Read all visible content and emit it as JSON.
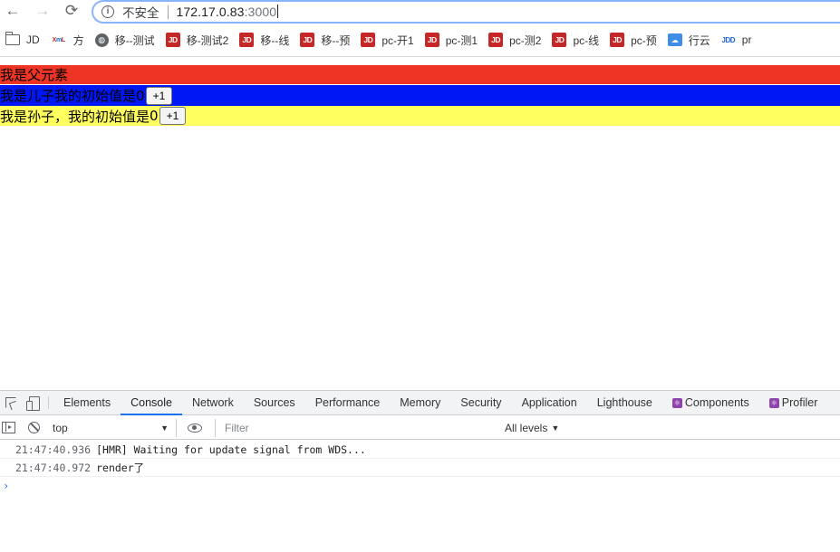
{
  "browser": {
    "back_icon": "←",
    "forward_icon": "→",
    "reload_icon": "⟳",
    "security_label": "不安全",
    "url_host": "172.17.0.83",
    "url_port": ":3000"
  },
  "bookmarks": [
    {
      "icon": "folder-icon",
      "label": "JD"
    },
    {
      "icon": "xl-icon",
      "label": "方"
    },
    {
      "icon": "globe-icon",
      "label": "移--测试"
    },
    {
      "icon": "jd-icon",
      "label": "移-测试2"
    },
    {
      "icon": "jd-icon",
      "label": "移--线"
    },
    {
      "icon": "jd-icon",
      "label": "移--预"
    },
    {
      "icon": "jd-icon",
      "label": "pc-开1"
    },
    {
      "icon": "jd-icon",
      "label": "pc-测1"
    },
    {
      "icon": "jd-icon",
      "label": "pc-测2"
    },
    {
      "icon": "jd-icon",
      "label": "pc-线"
    },
    {
      "icon": "jd-icon",
      "label": "pc-预"
    },
    {
      "icon": "cloud-icon",
      "label": "行云"
    },
    {
      "icon": "jdd-icon",
      "label": "pr"
    }
  ],
  "page": {
    "parent_text": "我是父元素",
    "child_text": "我是儿子我的初始值是",
    "child_value": "0",
    "grandchild_text": "我是孙子，我的初始值是",
    "grandchild_value": "0",
    "increment_label": "+1"
  },
  "devtools": {
    "tabs": [
      {
        "label": "Elements",
        "active": false
      },
      {
        "label": "Console",
        "active": true
      },
      {
        "label": "Network",
        "active": false
      },
      {
        "label": "Sources",
        "active": false
      },
      {
        "label": "Performance",
        "active": false
      },
      {
        "label": "Memory",
        "active": false
      },
      {
        "label": "Security",
        "active": false
      },
      {
        "label": "Application",
        "active": false
      },
      {
        "label": "Lighthouse",
        "active": false
      },
      {
        "label": "Components",
        "active": false,
        "react": true
      },
      {
        "label": "Profiler",
        "active": false,
        "react": true
      }
    ],
    "context": "top",
    "filter_placeholder": "Filter",
    "levels": "All levels",
    "logs": [
      {
        "time": "21:47:40.936",
        "message": "[HMR] Waiting for update signal from WDS..."
      },
      {
        "time": "21:47:40.972",
        "message": "render了"
      }
    ],
    "prompt_symbol": "›"
  },
  "colors": {
    "parent_bg": "#ee3424",
    "child_bg": "#0017f5",
    "grandchild_bg": "#ffff60",
    "accent": "#1a73e8"
  }
}
